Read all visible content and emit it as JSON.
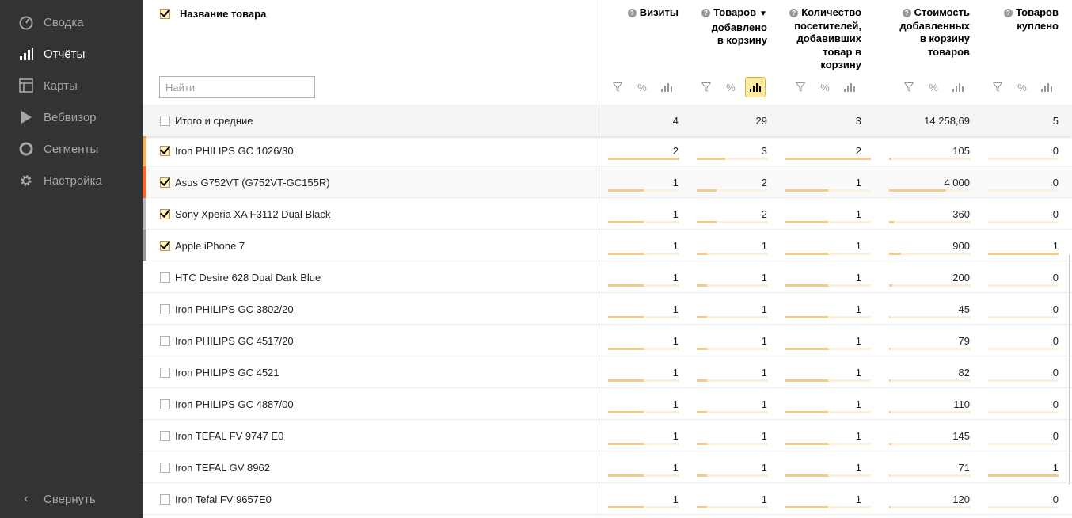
{
  "sidebar": {
    "items": [
      {
        "label": "Сводка",
        "icon": "gauge-icon",
        "active": false
      },
      {
        "label": "Отчёты",
        "icon": "bar-chart-icon",
        "active": true
      },
      {
        "label": "Карты",
        "icon": "map-layout-icon",
        "active": false
      },
      {
        "label": "Вебвизор",
        "icon": "play-icon",
        "active": false
      },
      {
        "label": "Сегменты",
        "icon": "segments-icon",
        "active": false
      },
      {
        "label": "Настройка",
        "icon": "gear-icon",
        "active": false
      }
    ],
    "collapse_label": "Свернуть"
  },
  "table": {
    "name_header": "Название товара",
    "search_placeholder": "Найти",
    "columns": [
      {
        "title_lines": [
          "Визиты"
        ],
        "sorted": false
      },
      {
        "title_lines": [
          "Товаров",
          "добавлено",
          "в корзину"
        ],
        "sorted": true
      },
      {
        "title_lines": [
          "Количество",
          "посетителей,",
          "добавивших",
          "товар в",
          "корзину"
        ],
        "sorted": false
      },
      {
        "title_lines": [
          "Стоимость",
          "добавленных",
          "в корзину",
          "товаров"
        ],
        "sorted": false
      },
      {
        "title_lines": [
          "Товаров",
          "куплено"
        ],
        "sorted": false
      }
    ],
    "tool_icons": [
      "filter-icon",
      "percent-icon",
      "bar-chart-icon"
    ],
    "percent_glyph": "%",
    "selected_tool_column": 1,
    "totals": {
      "label": "Итого и средние",
      "values": [
        "4",
        "29",
        "3",
        "14 258,69",
        "5"
      ]
    },
    "rows": [
      {
        "name": "Iron PHILIPS GC 1026/30",
        "checked": true,
        "stripe": "#f4b26a",
        "values": [
          "2",
          "3",
          "2",
          "105",
          "0"
        ],
        "bars": [
          1.0,
          0.4,
          1.0,
          0.03,
          0.0
        ]
      },
      {
        "name": "Asus G752VT (G752VT-GC155R)",
        "checked": true,
        "stripe": "#f26b3a",
        "values": [
          "1",
          "2",
          "1",
          "4 000",
          "0"
        ],
        "bars": [
          0.5,
          0.28,
          0.5,
          0.7,
          0.0
        ]
      },
      {
        "name": "Sony Xperia XA F3112 Dual Black",
        "checked": true,
        "stripe": "#bbbbbb",
        "values": [
          "1",
          "2",
          "1",
          "360",
          "0"
        ],
        "bars": [
          0.5,
          0.28,
          0.5,
          0.06,
          0.0
        ]
      },
      {
        "name": "Apple iPhone 7",
        "checked": true,
        "stripe": "#999999",
        "values": [
          "1",
          "1",
          "1",
          "900",
          "1"
        ],
        "bars": [
          0.5,
          0.14,
          0.5,
          0.15,
          1.0
        ]
      },
      {
        "name": "HTC Desire 628 Dual Dark Blue",
        "checked": false,
        "stripe": "",
        "values": [
          "1",
          "1",
          "1",
          "200",
          "0"
        ],
        "bars": [
          0.5,
          0.14,
          0.5,
          0.04,
          0.0
        ]
      },
      {
        "name": "Iron PHILIPS GC 3802/20",
        "checked": false,
        "stripe": "",
        "values": [
          "1",
          "1",
          "1",
          "45",
          "0"
        ],
        "bars": [
          0.5,
          0.14,
          0.5,
          0.01,
          0.0
        ]
      },
      {
        "name": "Iron PHILIPS GC 4517/20",
        "checked": false,
        "stripe": "",
        "values": [
          "1",
          "1",
          "1",
          "79",
          "0"
        ],
        "bars": [
          0.5,
          0.14,
          0.5,
          0.02,
          0.0
        ]
      },
      {
        "name": "Iron PHILIPS GC 4521",
        "checked": false,
        "stripe": "",
        "values": [
          "1",
          "1",
          "1",
          "82",
          "0"
        ],
        "bars": [
          0.5,
          0.14,
          0.5,
          0.02,
          0.0
        ]
      },
      {
        "name": "Iron PHILIPS GC 4887/00",
        "checked": false,
        "stripe": "",
        "values": [
          "1",
          "1",
          "1",
          "110",
          "0"
        ],
        "bars": [
          0.5,
          0.14,
          0.5,
          0.02,
          0.0
        ]
      },
      {
        "name": "Iron TEFAL FV 9747 E0",
        "checked": false,
        "stripe": "",
        "values": [
          "1",
          "1",
          "1",
          "145",
          "0"
        ],
        "bars": [
          0.5,
          0.14,
          0.5,
          0.03,
          0.0
        ]
      },
      {
        "name": "Iron TEFAL GV 8962",
        "checked": false,
        "stripe": "",
        "values": [
          "1",
          "1",
          "1",
          "71",
          "1"
        ],
        "bars": [
          0.5,
          0.14,
          0.5,
          0.01,
          1.0
        ]
      },
      {
        "name": "Iron Tefal FV 9657E0",
        "checked": false,
        "stripe": "",
        "values": [
          "1",
          "1",
          "1",
          "120",
          "0"
        ],
        "bars": [
          0.5,
          0.14,
          0.5,
          0.02,
          0.0
        ]
      }
    ]
  }
}
